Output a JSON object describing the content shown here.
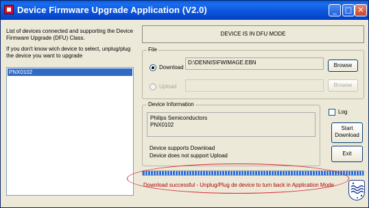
{
  "window": {
    "title": "Device Firmware Upgrade Application (V2.0)",
    "controls": {
      "minimize": "_",
      "maximize": "□",
      "close": "✕"
    }
  },
  "left_panel": {
    "description_1": "List of devices connected and supporting the Device Firmware Upgrade (DFU) Class.",
    "description_2": "If you don't know wich device to select, unplug/plug the device you want to upgrade",
    "devices": [
      {
        "label": "PNX0102",
        "selected": true
      }
    ]
  },
  "mode_status": "DEVICE IS IN DFU MODE",
  "file": {
    "group_label": "File",
    "download_label": "Download",
    "download_path": "D:\\DENNIS\\FWIMAGE.EBN",
    "download_selected": true,
    "download_browse": "Browse",
    "upload_label": "Upload",
    "upload_path": "",
    "upload_enabled": false,
    "upload_browse": "Browse"
  },
  "device_info": {
    "group_label": "Device Information",
    "manufacturer": "Philips Semiconductors",
    "product": "PNX0102",
    "support_download": "Device supports Download",
    "support_upload": "Device does not support Upload"
  },
  "log": {
    "label": "Log",
    "checked": false
  },
  "buttons": {
    "start_line1": "Start",
    "start_line2": "Download",
    "exit": "Exit"
  },
  "progress": {
    "value": 1.0
  },
  "status_message": "Download successful - Unplug/Plug de device to turn back in Application Mode",
  "colors": {
    "title_bar": "#0b53d8",
    "selection": "#316ac5",
    "status_text": "#b00000",
    "annotation": "#d9282f",
    "progress": "#2f6ed1"
  },
  "icons": {
    "app": "dfu-app-icon",
    "logo": "philips-shield-logo"
  }
}
